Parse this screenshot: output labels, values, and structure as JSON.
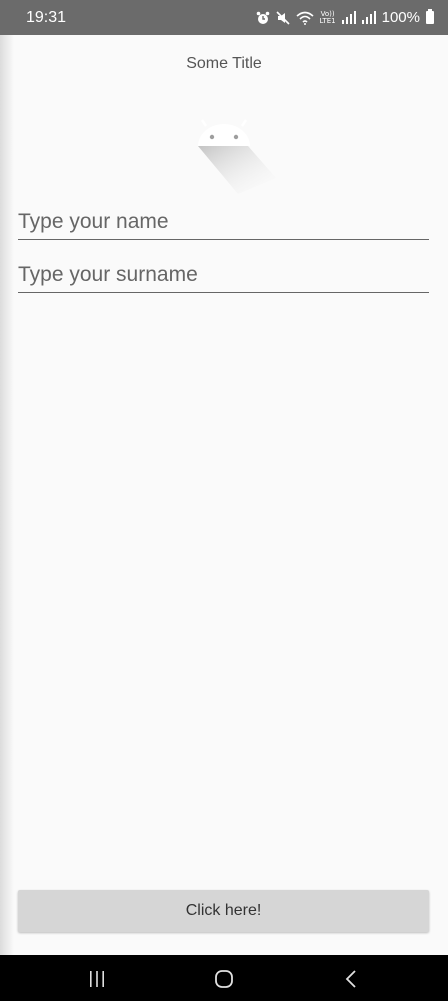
{
  "status_bar": {
    "time": "19:31",
    "volte_top": "Vo))",
    "volte_bottom": "LTE1",
    "battery_percent": "100%",
    "icons": [
      "alarm-icon",
      "mute-icon",
      "wifi-icon",
      "volte-icon",
      "signal-icon",
      "signal-icon",
      "battery-icon"
    ]
  },
  "page": {
    "title": "Some Title",
    "logo_icon": "android-logo-icon"
  },
  "form": {
    "name_placeholder": "Type your name",
    "name_value": "",
    "surname_placeholder": "Type your surname",
    "surname_value": ""
  },
  "button": {
    "label": "Click here!"
  },
  "nav_bar": {
    "icons": [
      "recents-icon",
      "home-icon",
      "back-icon"
    ]
  },
  "colors": {
    "status_bar": "#6b6b6b",
    "background": "#fafafa",
    "button": "#d6d6d6",
    "nav_bar": "#000000"
  }
}
